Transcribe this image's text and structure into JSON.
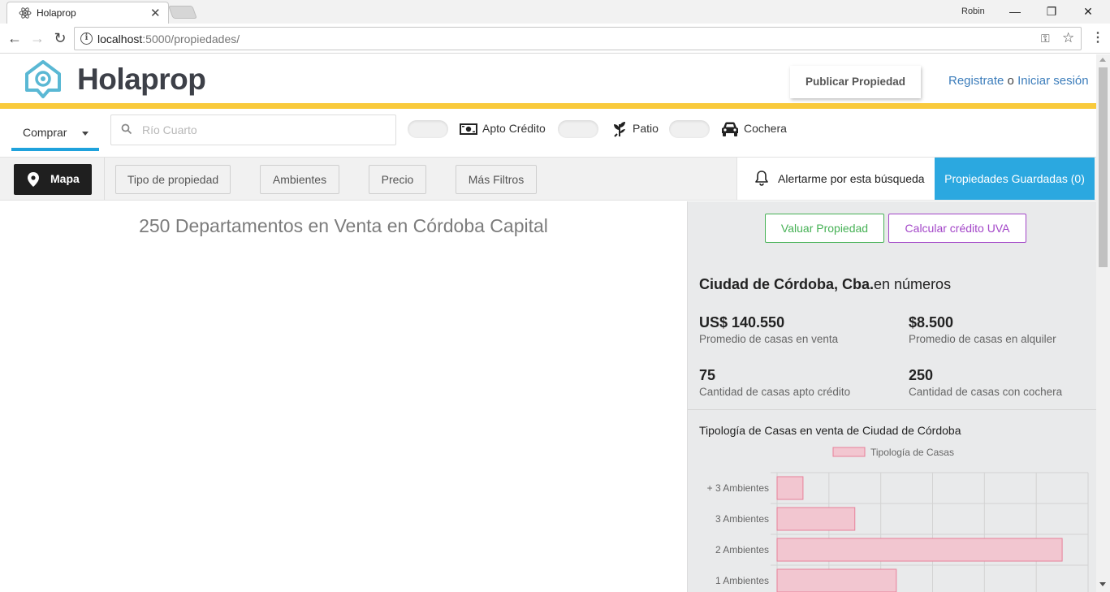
{
  "browser": {
    "tab_title": "Holaprop",
    "user": "Robin",
    "url_host": "localhost",
    "url_path": ":5000/propiedades/"
  },
  "header": {
    "logo_text": "Holaprop",
    "publish_label": "Publicar Propiedad",
    "register_label": "Registrate",
    "or_label": "o",
    "login_label": "Iniciar sesión"
  },
  "filters": {
    "operation": "Comprar",
    "search_placeholder": "Río Cuarto",
    "features": [
      {
        "label": "Apto Crédito",
        "icon": "money-icon",
        "enabled": false
      },
      {
        "label": "Patio",
        "icon": "plant-icon",
        "enabled": false
      },
      {
        "label": "Cochera",
        "icon": "car-icon",
        "enabled": false
      }
    ]
  },
  "toolbar": {
    "map_label": "Mapa",
    "property_type_label": "Tipo de propiedad",
    "rooms_label": "Ambientes",
    "price_label": "Precio",
    "more_filters_label": "Más Filtros",
    "alert_label": "Alertarme por esta búsqueda",
    "saved_label": "Propiedades Guardadas (0)"
  },
  "results": {
    "title": "250 Departamentos en Venta en Córdoba Capital"
  },
  "panel": {
    "valuate_label": "Valuar Propiedad",
    "credit_label": "Calcular crédito UVA",
    "city_name": "Ciudad de Córdoba, Cba.",
    "city_suffix": "en números",
    "stats": [
      {
        "value": "US$ 140.550",
        "label": "Promedio de casas en venta"
      },
      {
        "value": "$8.500",
        "label": "Promedio de casas en alquiler"
      },
      {
        "value": "75",
        "label": "Cantidad de casas apto crédito"
      },
      {
        "value": "250",
        "label": "Cantidad de casas con cochera"
      }
    ],
    "chart_title": "Tipología de Casas en venta de Ciudad de Córdoba"
  },
  "colors": {
    "accent_blue": "#2ba8e0",
    "yellow": "#f9ca3c",
    "green": "#46b155",
    "purple": "#a346c8",
    "bar_fill": "#f2c6d0",
    "bar_stroke": "#e8809a"
  },
  "chart_data": {
    "type": "bar",
    "orientation": "horizontal",
    "legend": "Tipología de Casas",
    "legend_position": "top",
    "categories": [
      "+ 3 Ambientes",
      "3 Ambientes",
      "2 Ambientes",
      "1 Ambientes"
    ],
    "series": [
      {
        "name": "Tipología de Casas",
        "values": [
          5,
          15,
          55,
          23
        ]
      }
    ],
    "xlim": [
      0,
      60
    ],
    "grid": true
  }
}
